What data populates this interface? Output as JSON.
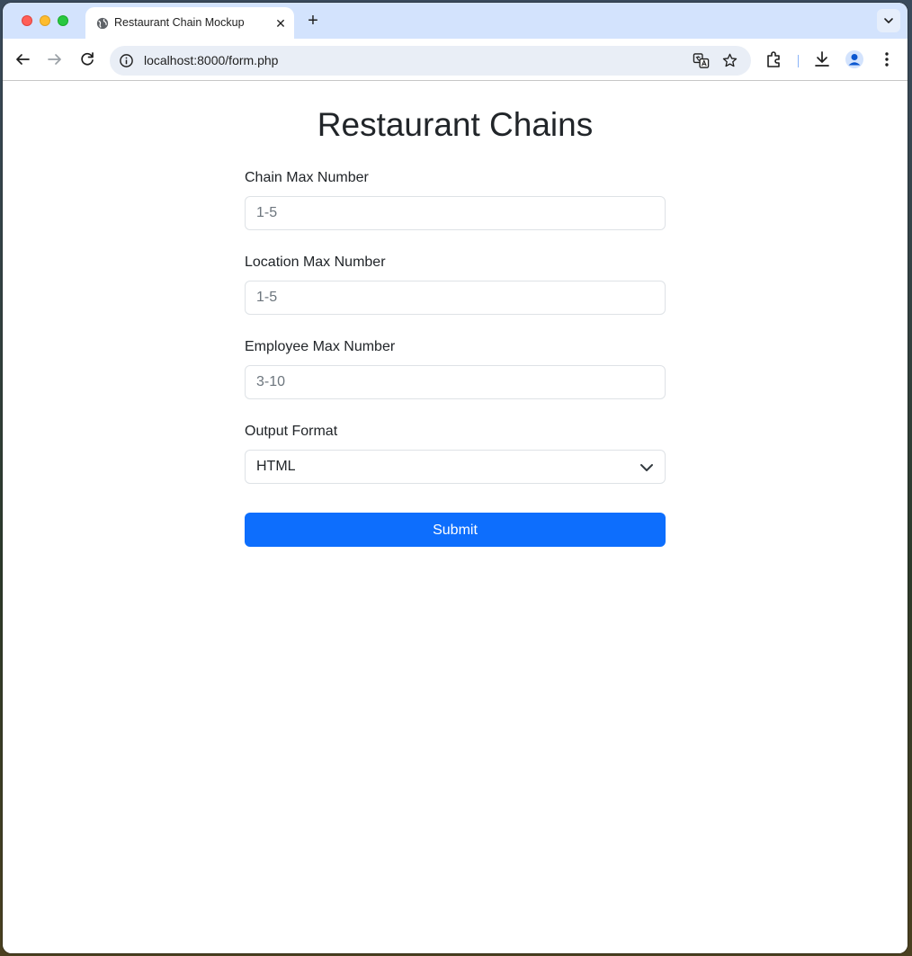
{
  "browser": {
    "tab_title": "Restaurant Chain Mockup",
    "tab_close_glyph": "✕",
    "new_tab_glyph": "+",
    "url": "localhost:8000/form.php"
  },
  "page": {
    "title": "Restaurant Chains",
    "fields": [
      {
        "label": "Chain Max Number",
        "placeholder": "1-5",
        "value": ""
      },
      {
        "label": "Location Max Number",
        "placeholder": "1-5",
        "value": ""
      },
      {
        "label": "Employee Max Number",
        "placeholder": "3-10",
        "value": ""
      }
    ],
    "output_format": {
      "label": "Output Format",
      "selected": "HTML"
    },
    "submit_label": "Submit"
  },
  "colors": {
    "accent": "#0d6efd",
    "tabstrip": "#d3e3fd",
    "text": "#212529"
  },
  "icons": [
    "globe-icon",
    "close-icon",
    "plus-icon",
    "chevron-down-icon",
    "back-icon",
    "forward-icon",
    "reload-icon",
    "info-icon",
    "translate-icon",
    "star-icon",
    "extensions-icon",
    "download-icon",
    "profile-icon",
    "more-icon"
  ]
}
